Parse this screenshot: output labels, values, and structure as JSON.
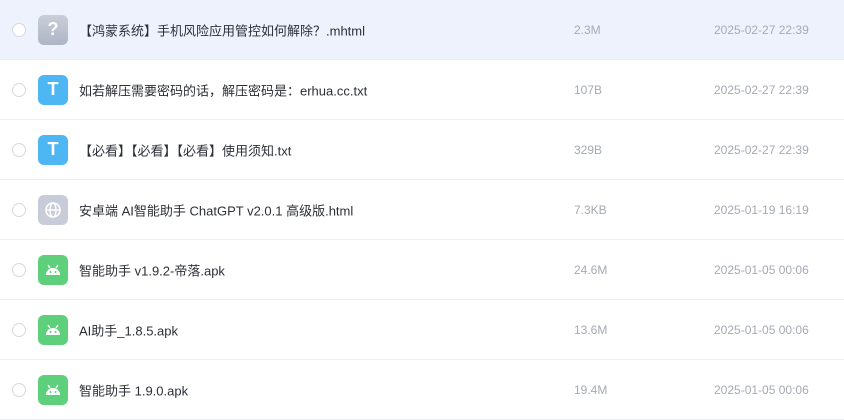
{
  "files": [
    {
      "name": "【鸿蒙系统】手机风险应用管控如何解除？.mhtml",
      "size": "2.3M",
      "date": "2025-02-27 22:39",
      "icon": "unknown-file-icon"
    },
    {
      "name": "如若解压需要密码的话，解压密码是：erhua.cc.txt",
      "size": "107B",
      "date": "2025-02-27 22:39",
      "icon": "text-file-icon"
    },
    {
      "name": "【必看】【必看】【必看】使用须知.txt",
      "size": "329B",
      "date": "2025-02-27 22:39",
      "icon": "text-file-icon"
    },
    {
      "name": "安卓端 AI智能助手 ChatGPT v2.0.1 高级版.html",
      "size": "7.3KB",
      "date": "2025-01-19 16:19",
      "icon": "web-file-icon"
    },
    {
      "name": "智能助手 v1.9.2-帝落.apk",
      "size": "24.6M",
      "date": "2025-01-05 00:06",
      "icon": "android-apk-icon"
    },
    {
      "name": "AI助手_1.8.5.apk",
      "size": "13.6M",
      "date": "2025-01-05 00:06",
      "icon": "android-apk-icon"
    },
    {
      "name": "智能助手 1.9.0.apk",
      "size": "19.4M",
      "date": "2025-01-05 00:06",
      "icon": "android-apk-icon"
    }
  ],
  "icon_glyphs": {
    "unknown": "?",
    "text": "T"
  },
  "colors": {
    "selected_row": "#eef2fd",
    "text_icon": "#4eb6f2",
    "apk_icon": "#5ecf7a",
    "web_icon": "#c7ccd8"
  }
}
